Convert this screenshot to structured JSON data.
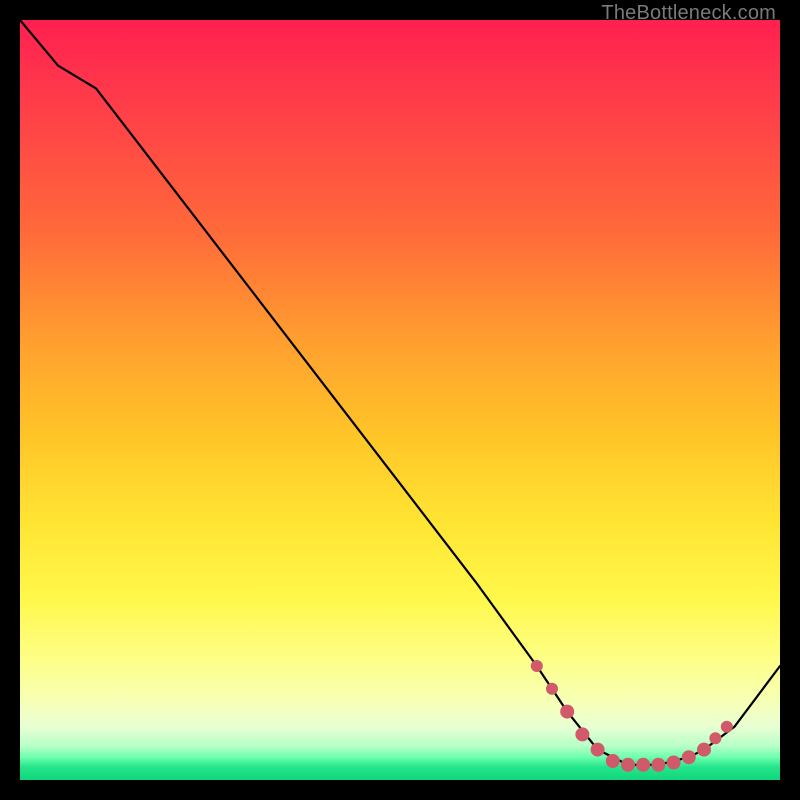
{
  "watermark": "TheBottleneck.com",
  "chart_data": {
    "type": "line",
    "title": "",
    "xlabel": "",
    "ylabel": "",
    "xlim": [
      0,
      100
    ],
    "ylim": [
      0,
      100
    ],
    "series": [
      {
        "name": "curve",
        "x": [
          0,
          5,
          10,
          20,
          30,
          40,
          50,
          60,
          68,
          72,
          76,
          80,
          84,
          88,
          90,
          94,
          100
        ],
        "values": [
          100,
          94,
          91,
          78,
          65,
          52,
          39,
          26,
          15,
          9,
          4,
          2,
          2,
          3,
          4,
          7,
          15
        ]
      }
    ],
    "markers": {
      "name": "highlight-dots",
      "color": "#d15a6a",
      "x": [
        68,
        70,
        72,
        74,
        76,
        78,
        80,
        82,
        84,
        86,
        88,
        90,
        91.5,
        93
      ],
      "values": [
        15,
        12,
        9,
        6,
        4,
        2.5,
        2,
        2,
        2,
        2.3,
        3,
        4,
        5.5,
        7
      ]
    },
    "annotations": [
      {
        "text": "TheBottleneck.com",
        "position": "top-right"
      }
    ]
  }
}
